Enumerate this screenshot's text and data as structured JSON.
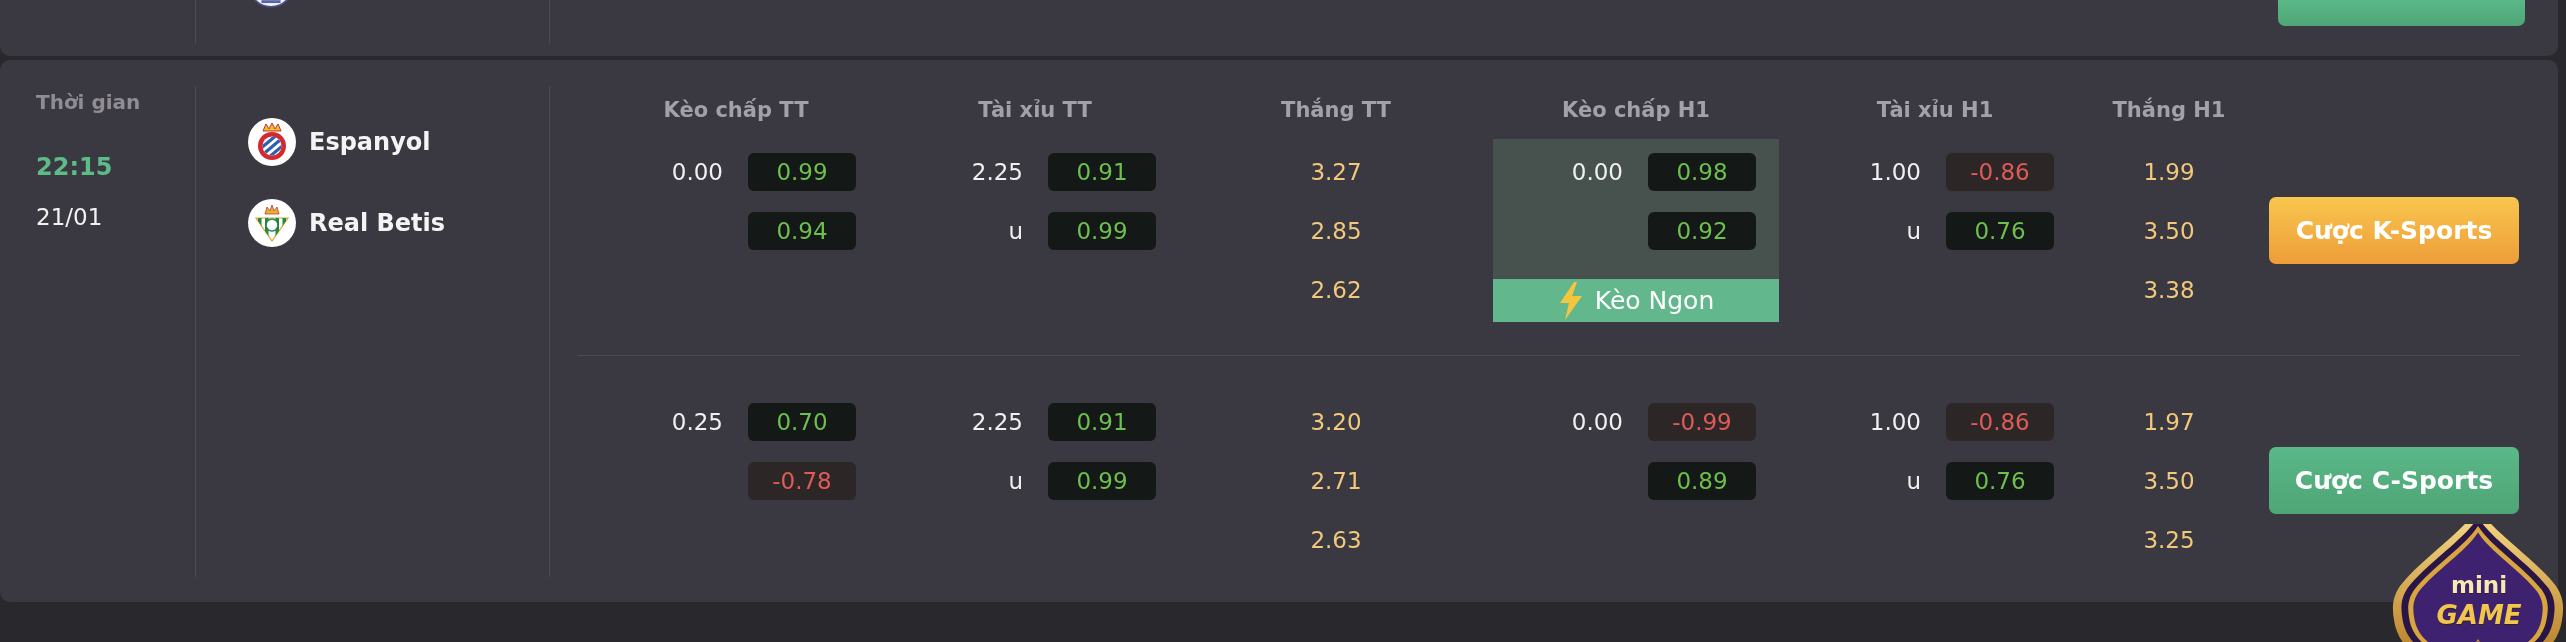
{
  "previous_match": {
    "bet_button": {
      "kind": "c_sports"
    }
  },
  "match": {
    "time_label": "Thời gian",
    "kickoff_time": "22:15",
    "kickoff_date": "21/01",
    "teams": [
      {
        "name": "Espanyol"
      },
      {
        "name": "Real Betis"
      }
    ],
    "market_headers": [
      "Kèo chấp TT",
      "Tài xỉu TT",
      "Thắng TT",
      "Kèo chấp H1",
      "Tài xỉu H1",
      "Thắng H1"
    ],
    "lines": [
      {
        "markets": [
          {
            "kind": "handicap",
            "highlighted": false,
            "prices": [
              {
                "label": "0.00",
                "value": "0.99",
                "negative": false
              },
              {
                "value": "0.94",
                "negative": false
              }
            ]
          },
          {
            "kind": "over_under",
            "highlighted": false,
            "prices": [
              {
                "label": "2.25",
                "value": "0.91",
                "negative": false
              },
              {
                "label": "u",
                "value": "0.99",
                "negative": false
              }
            ]
          },
          {
            "kind": "win",
            "highlighted": false,
            "values": [
              "3.27",
              "2.85",
              "2.62"
            ]
          },
          {
            "kind": "handicap",
            "highlighted": true,
            "badge": "Kèo Ngon",
            "prices": [
              {
                "label": "0.00",
                "value": "0.98",
                "negative": false
              },
              {
                "value": "0.92",
                "negative": false
              }
            ]
          },
          {
            "kind": "over_under",
            "highlighted": false,
            "prices": [
              {
                "label": "1.00",
                "value": "-0.86",
                "negative": true
              },
              {
                "label": "u",
                "value": "0.76",
                "negative": false
              }
            ]
          },
          {
            "kind": "win",
            "highlighted": false,
            "values": [
              "1.99",
              "3.50",
              "3.38"
            ]
          }
        ],
        "bet_button": {
          "kind": "k_sports",
          "label": "Cược K-Sports"
        }
      },
      {
        "markets": [
          {
            "kind": "handicap",
            "highlighted": false,
            "prices": [
              {
                "label": "0.25",
                "value": "0.70",
                "negative": false
              },
              {
                "value": "-0.78",
                "negative": true
              }
            ]
          },
          {
            "kind": "over_under",
            "highlighted": false,
            "prices": [
              {
                "label": "2.25",
                "value": "0.91",
                "negative": false
              },
              {
                "label": "u",
                "value": "0.99",
                "negative": false
              }
            ]
          },
          {
            "kind": "win",
            "highlighted": false,
            "values": [
              "3.20",
              "2.71",
              "2.63"
            ]
          },
          {
            "kind": "handicap",
            "highlighted": false,
            "prices": [
              {
                "label": "0.00",
                "value": "-0.99",
                "negative": true
              },
              {
                "value": "0.89",
                "negative": false
              }
            ]
          },
          {
            "kind": "over_under",
            "highlighted": false,
            "prices": [
              {
                "label": "1.00",
                "value": "-0.86",
                "negative": true
              },
              {
                "label": "u",
                "value": "0.76",
                "negative": false
              }
            ]
          },
          {
            "kind": "win",
            "highlighted": false,
            "values": [
              "1.97",
              "3.50",
              "3.25"
            ]
          }
        ],
        "bet_button": {
          "kind": "c_sports",
          "label": "Cược C-Sports"
        }
      }
    ]
  },
  "mini_game_badge": {
    "line_1": "mini",
    "line_2": "GAME"
  }
}
